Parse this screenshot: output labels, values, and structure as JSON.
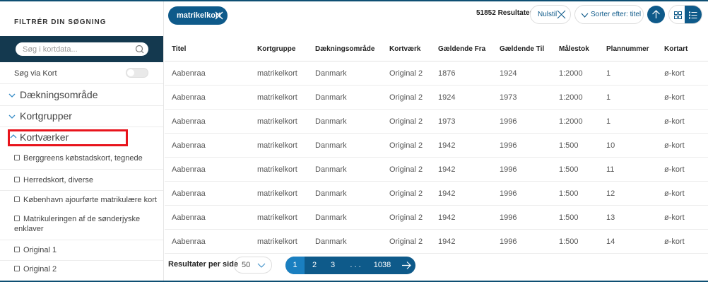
{
  "sidebar": {
    "title": "FILTRÉR DIN SØGNING",
    "search_placeholder": "Søg i kortdata...",
    "map_search_label": "Søg via Kort",
    "accordions": [
      "Dækningsområde",
      "Kortgrupper",
      "Kortværker"
    ],
    "kortvaerker_items": [
      "Berggreens købstadskort, tegnede",
      "Herredskort, diverse",
      "København ajourførte matrikulære kort",
      "Matrikuleringen af de sønderjyske",
      "enklaver",
      "Original 1",
      "Original 2"
    ]
  },
  "topbar": {
    "active_filter": "matrikelkort",
    "results_count": "51852 Resultater",
    "reset_label": "Nulstil",
    "sort_label": "Sorter efter: titel"
  },
  "table": {
    "headers": [
      "Titel",
      "Kortgruppe",
      "Dækningsområde",
      "Kortværk",
      "Gældende Fra",
      "Gældende Til",
      "Målestok",
      "Plannummer",
      "Kortart"
    ],
    "rows": [
      [
        "Aabenraa",
        "matrikelkort",
        "Danmark",
        "Original 2",
        "1876",
        "1924",
        "1:2000",
        "1",
        "ø-kort"
      ],
      [
        "Aabenraa",
        "matrikelkort",
        "Danmark",
        "Original 2",
        "1924",
        "1973",
        "1:2000",
        "1",
        "ø-kort"
      ],
      [
        "Aabenraa",
        "matrikelkort",
        "Danmark",
        "Original 2",
        "1973",
        "1996",
        "1:2000",
        "1",
        "ø-kort"
      ],
      [
        "Aabenraa",
        "matrikelkort",
        "Danmark",
        "Original 2",
        "1942",
        "1996",
        "1:500",
        "10",
        "ø-kort"
      ],
      [
        "Aabenraa",
        "matrikelkort",
        "Danmark",
        "Original 2",
        "1942",
        "1996",
        "1:500",
        "11",
        "ø-kort"
      ],
      [
        "Aabenraa",
        "matrikelkort",
        "Danmark",
        "Original 2",
        "1942",
        "1996",
        "1:500",
        "12",
        "ø-kort"
      ],
      [
        "Aabenraa",
        "matrikelkort",
        "Danmark",
        "Original 2",
        "1942",
        "1996",
        "1:500",
        "13",
        "ø-kort"
      ],
      [
        "Aabenraa",
        "matrikelkort",
        "Danmark",
        "Original 2",
        "1942",
        "1996",
        "1:500",
        "14",
        "ø-kort"
      ]
    ]
  },
  "footer": {
    "per_page_label": "Resultater per side",
    "per_page_value": "50",
    "pages": [
      "1",
      "2",
      "3",
      ". . .",
      "1038"
    ]
  },
  "colors": {
    "primary": "#0e5a8a",
    "dark": "#14394f",
    "highlight": "#e8141c"
  }
}
